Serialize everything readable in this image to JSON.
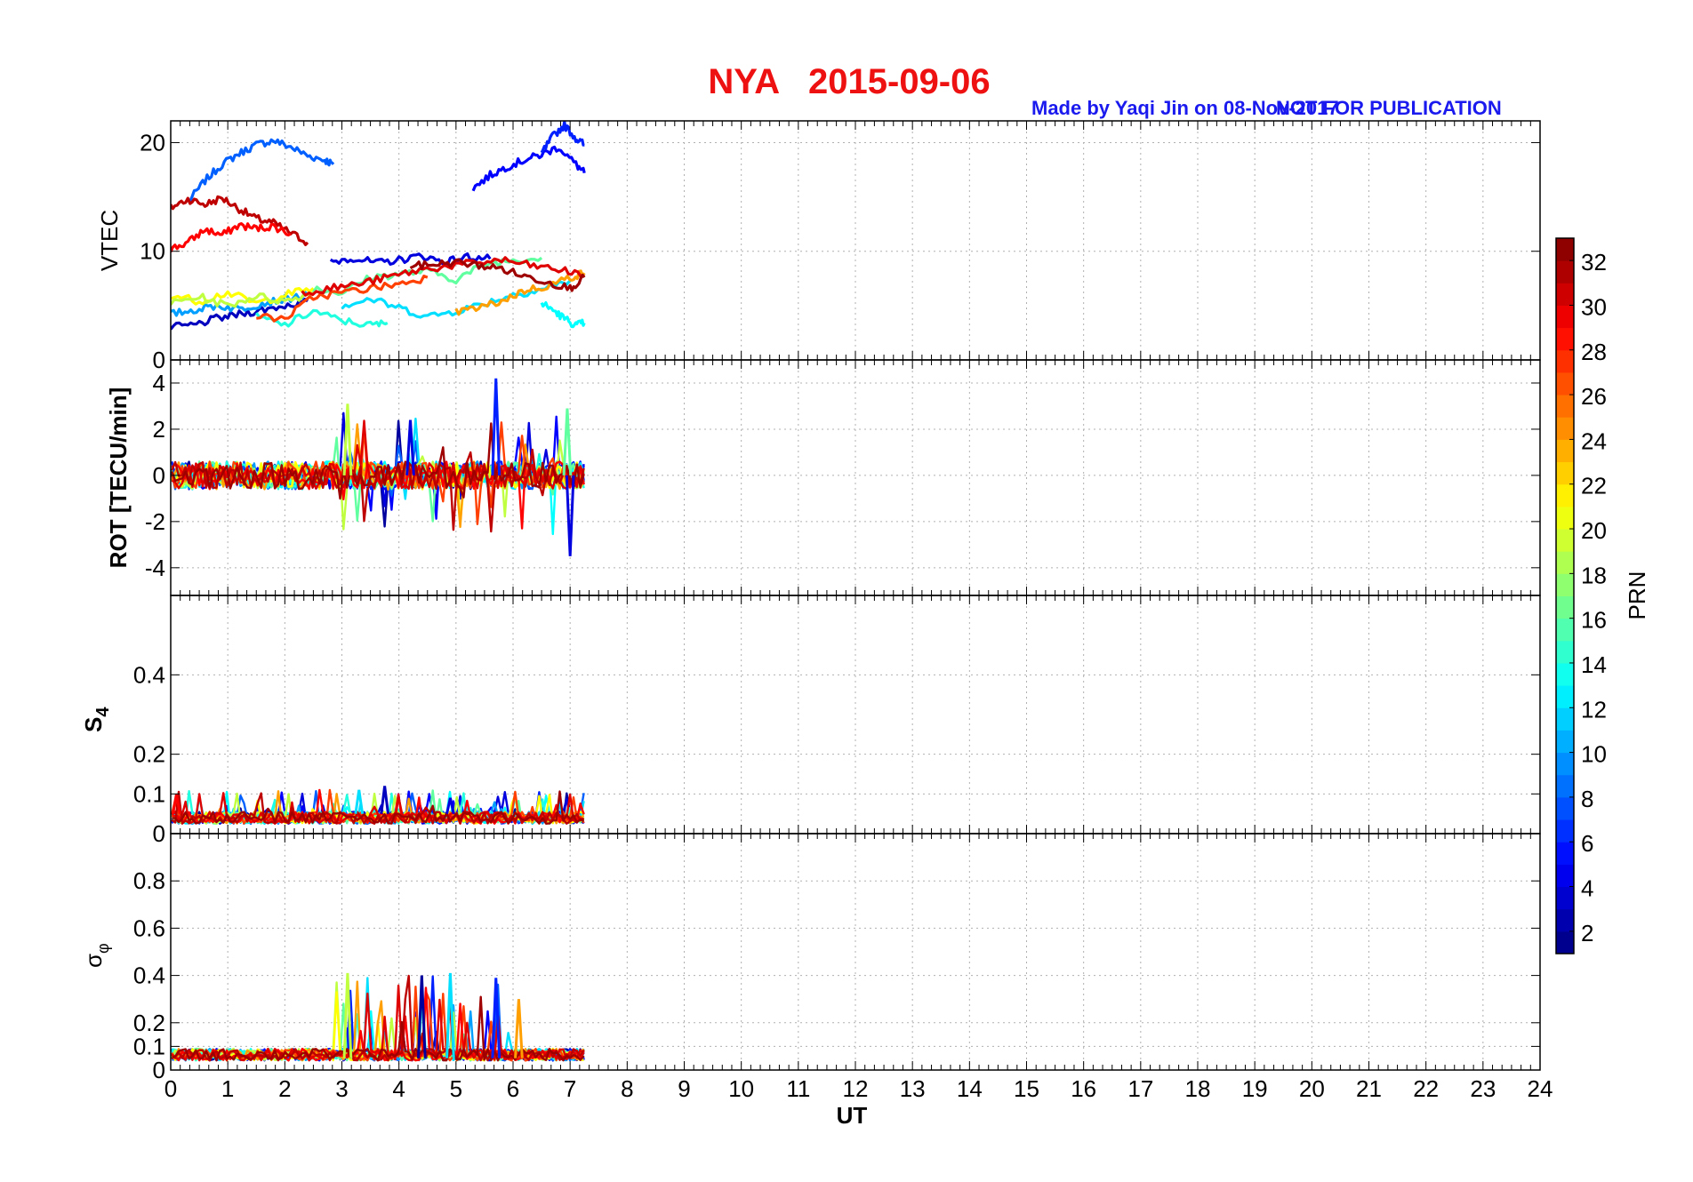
{
  "header": {
    "title": "NYA   2015-09-06",
    "credit": "Made by Yaqi Jin on 08-Nov-2017",
    "notice": "NOT FOR PUBLICATION",
    "title_color": "#ee1111",
    "credit_color": "#1a1aee"
  },
  "chart_data": [
    {
      "type": "line",
      "panel": "VTEC",
      "ylabel": "VTEC",
      "xlim": [
        0,
        24
      ],
      "ylim": [
        0,
        22
      ],
      "yticks": [
        0,
        10,
        20
      ],
      "grid": true,
      "series": [
        {
          "prn": 8,
          "x": [
            0.3,
            0.6,
            0.9,
            1.2,
            1.5,
            1.8,
            2.1,
            2.4,
            2.7,
            2.85
          ],
          "y": [
            14.5,
            16.5,
            18,
            19,
            19.8,
            20.2,
            19.6,
            18.8,
            18.4,
            18.0
          ]
        },
        {
          "prn": 31,
          "x": [
            0,
            0.3,
            0.6,
            0.9,
            1.2,
            1.5,
            1.8,
            2.1,
            2.4
          ],
          "y": [
            14.0,
            14.8,
            14.3,
            14.9,
            13.9,
            13.0,
            12.6,
            11.7,
            10.8
          ]
        },
        {
          "prn": 29,
          "x": [
            0,
            0.3,
            0.6,
            0.9,
            1.2,
            1.5,
            1.8,
            2.1
          ],
          "y": [
            10.2,
            10.8,
            12.0,
            11.5,
            12.4,
            12.1,
            12.3,
            11.6
          ]
        },
        {
          "prn": 5,
          "x": [
            5.3,
            5.6,
            5.9,
            6.2,
            6.5,
            6.8,
            7.1,
            7.25
          ],
          "y": [
            15.8,
            17.0,
            17.8,
            18.4,
            18.9,
            19.6,
            18.0,
            17.2
          ]
        },
        {
          "prn": 6,
          "x": [
            6.5,
            6.7,
            6.9,
            7.1,
            7.25
          ],
          "y": [
            19.0,
            20.6,
            21.6,
            20.4,
            19.8
          ]
        },
        {
          "prn": 4,
          "x": [
            2.8,
            3.2,
            3.6,
            4.0,
            4.4,
            4.8,
            5.2,
            5.6
          ],
          "y": [
            9.0,
            9.4,
            8.9,
            9.2,
            9.6,
            9.0,
            9.5,
            9.3
          ]
        },
        {
          "prn": 3,
          "x": [
            0,
            0.4,
            0.8,
            1.2,
            1.6,
            2.0,
            2.4
          ],
          "y": [
            3.0,
            3.2,
            3.8,
            4.2,
            4.6,
            5.0,
            5.4
          ]
        },
        {
          "prn": 10,
          "x": [
            0,
            0.4,
            0.8,
            1.2,
            1.6,
            2.0,
            2.4
          ],
          "y": [
            4.2,
            4.6,
            5.0,
            4.7,
            5.2,
            5.6,
            6.0
          ]
        },
        {
          "prn": 14,
          "x": [
            1.5,
            2.0,
            2.5,
            3.0,
            3.5,
            3.8
          ],
          "y": [
            4.0,
            3.2,
            4.5,
            3.6,
            3.2,
            3.4
          ]
        },
        {
          "prn": 21,
          "x": [
            0,
            0.5,
            1.0,
            1.5,
            2.0,
            2.5
          ],
          "y": [
            6.0,
            5.4,
            6.2,
            5.2,
            6.0,
            6.6
          ]
        },
        {
          "prn": 19,
          "x": [
            0,
            0.5,
            1.0,
            1.5,
            2.0,
            2.5
          ],
          "y": [
            5.2,
            5.8,
            5.0,
            5.9,
            5.4,
            6.2
          ]
        },
        {
          "prn": 16,
          "x": [
            2.5,
            3.0,
            3.5,
            4.0,
            4.5,
            5.0,
            5.5,
            6.0,
            6.5
          ],
          "y": [
            6.6,
            6.2,
            7.6,
            7.9,
            8.2,
            7.4,
            8.8,
            9.2,
            9.4
          ]
        },
        {
          "prn": 12,
          "x": [
            3.0,
            3.5,
            4.0,
            4.5,
            5.0,
            5.5,
            6.0,
            6.5,
            7.0
          ],
          "y": [
            5.0,
            5.6,
            4.8,
            4.0,
            4.5,
            5.2,
            6.0,
            6.5,
            7.3
          ]
        },
        {
          "prn": 13,
          "x": [
            6.5,
            6.7,
            6.9,
            7.1,
            7.25
          ],
          "y": [
            5.2,
            4.6,
            3.8,
            3.2,
            3.4
          ]
        },
        {
          "prn": 24,
          "x": [
            5.0,
            5.4,
            5.8,
            6.2,
            6.6,
            7.0,
            7.25
          ],
          "y": [
            4.4,
            4.8,
            5.4,
            6.4,
            6.8,
            7.6,
            8.0
          ]
        },
        {
          "prn": 27,
          "x": [
            1.5,
            2.0,
            2.5,
            3.0,
            3.5,
            4.0,
            4.5
          ],
          "y": [
            4.0,
            3.8,
            5.8,
            6.2,
            6.6,
            7.0,
            7.6
          ]
        },
        {
          "prn": 30,
          "x": [
            2.3,
            2.8,
            3.3,
            3.8,
            4.3,
            4.8,
            5.3,
            5.8,
            6.3,
            6.8,
            7.25
          ],
          "y": [
            6.2,
            6.6,
            7.0,
            7.6,
            8.2,
            8.6,
            8.9,
            9.2,
            8.7,
            8.3,
            7.8
          ]
        },
        {
          "prn": 32,
          "x": [
            4.2,
            4.6,
            5.0,
            5.4,
            5.8,
            6.2,
            6.6,
            7.0,
            7.25
          ],
          "y": [
            8.6,
            8.8,
            9.0,
            8.7,
            8.4,
            7.7,
            7.2,
            6.6,
            7.6
          ]
        }
      ]
    },
    {
      "type": "line",
      "panel": "ROT",
      "ylabel": "ROT [TECU/min]",
      "xlim": [
        0,
        24
      ],
      "ylim": [
        -5.2,
        5.0
      ],
      "yticks": [
        -4,
        -2,
        0,
        2,
        4
      ],
      "grid": true,
      "note": "noisy per-PRN series oscillating around 0 between UT 0 and 7.25 with spikes up to about 4.2 and down to about -3.5"
    },
    {
      "type": "line",
      "panel": "S4",
      "ylabel": "S4",
      "xlim": [
        0,
        24
      ],
      "ylim": [
        0,
        0.6
      ],
      "yticks": [
        0,
        0.1,
        0.2,
        0.4
      ],
      "grid": true,
      "note": "per-PRN series mostly 0.02-0.06 between UT 0 and 7.25 with peaks near 0.12"
    },
    {
      "type": "line",
      "panel": "sigma_phi",
      "ylabel": "σ_φ",
      "xlim": [
        0,
        24
      ],
      "ylim": [
        0,
        1.0
      ],
      "yticks": [
        0,
        0.1,
        0.2,
        0.4,
        0.6,
        0.8
      ],
      "xticks": [
        0,
        1,
        2,
        3,
        4,
        5,
        6,
        7,
        8,
        9,
        10,
        11,
        12,
        13,
        14,
        15,
        16,
        17,
        18,
        19,
        20,
        21,
        22,
        23,
        24
      ],
      "xlabel": "UT",
      "grid": true,
      "note": "per-PRN series mostly 0.04-0.1 between UT 0 and 7.25 with peaks near 0.4 at UT 3.1, 4.4, 4.9 and 5.7"
    }
  ],
  "colorbar": {
    "label": "PRN",
    "ticks": [
      2,
      4,
      6,
      8,
      10,
      12,
      14,
      16,
      18,
      20,
      22,
      24,
      26,
      28,
      30,
      32
    ],
    "range": [
      1,
      33
    ]
  }
}
